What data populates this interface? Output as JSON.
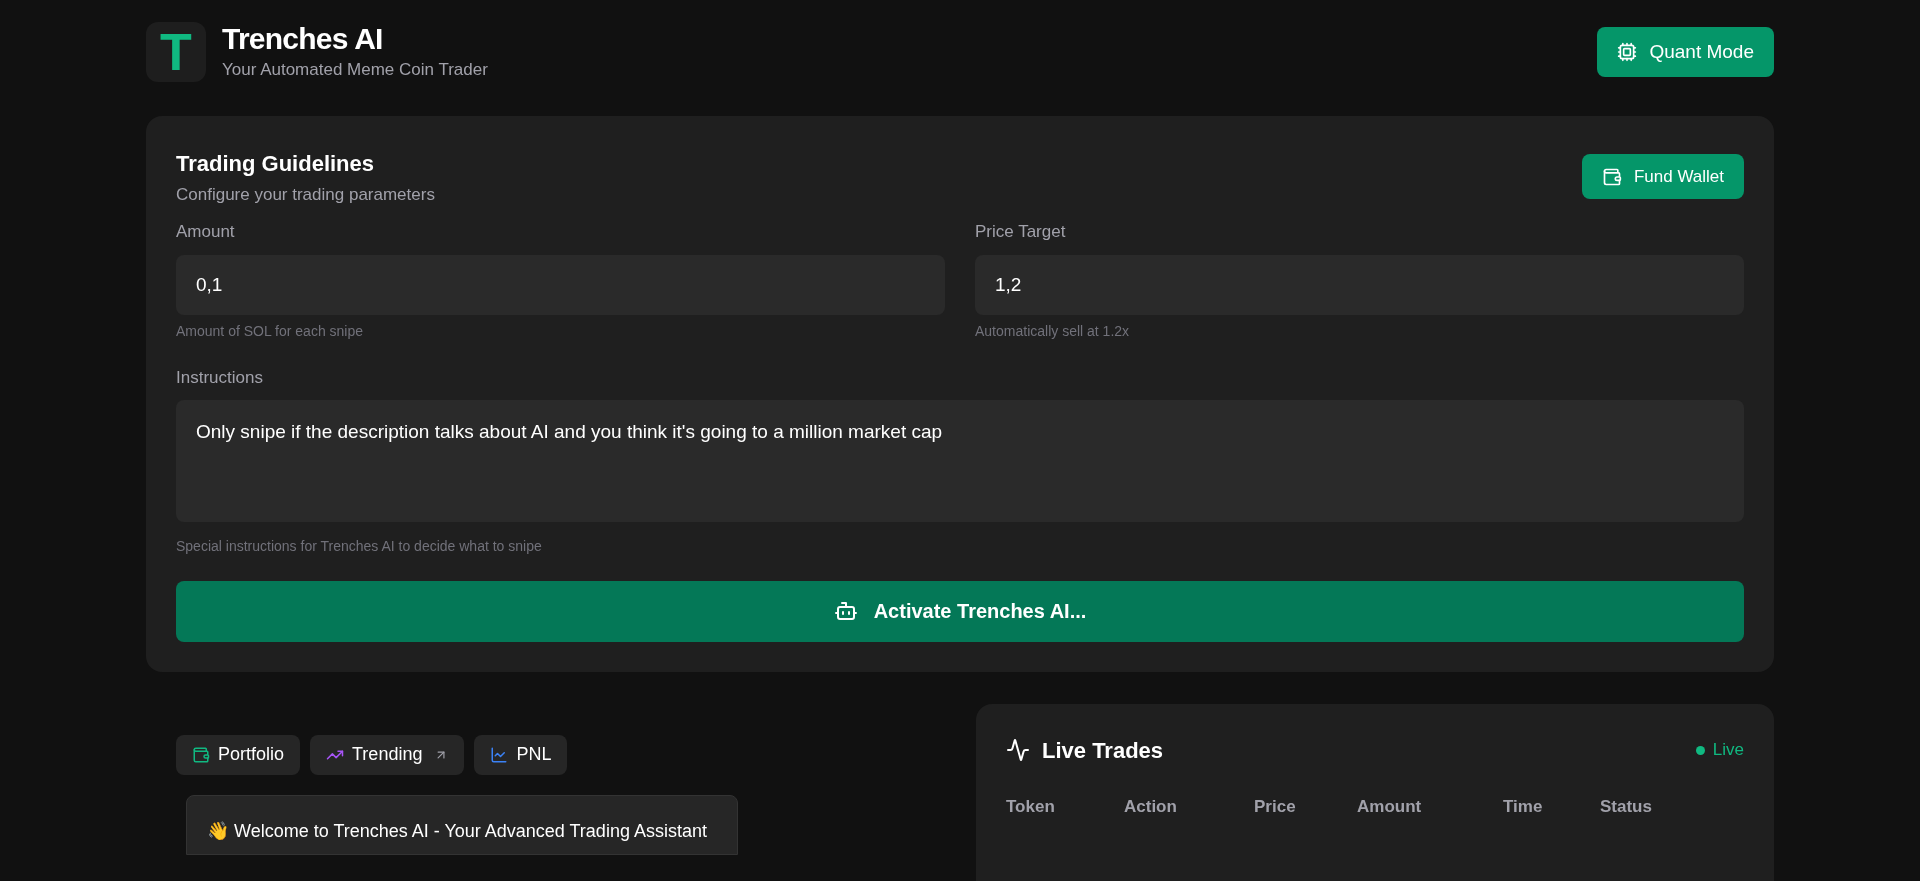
{
  "header": {
    "logo_letter": "T",
    "title": "Trenches AI",
    "subtitle": "Your Automated Meme Coin Trader",
    "quant_button": "Quant Mode"
  },
  "guidelines": {
    "title": "Trading Guidelines",
    "subtitle": "Configure your trading parameters",
    "fund_button": "Fund Wallet",
    "fields": [
      {
        "label": "Amount",
        "value": "0,1",
        "hint": "Amount of SOL for each snipe"
      },
      {
        "label": "Price Target",
        "value": "1,2",
        "hint": "Automatically sell at 1.2x"
      }
    ],
    "instructions": {
      "label": "Instructions",
      "value": "Only snipe if the description talks about AI and you think it's going to a million market cap",
      "hint": "Special instructions for Trenches AI to decide what to snipe"
    },
    "activate_button": "Activate Trenches AI..."
  },
  "tabs": [
    {
      "label": "Portfolio",
      "kind": "wallet"
    },
    {
      "label": "Trending",
      "kind": "trending"
    },
    {
      "label": "PNL",
      "kind": "chart"
    }
  ],
  "chat": {
    "message": "👋 Welcome to Trenches AI - Your Advanced Trading Assistant"
  },
  "live_trades": {
    "title": "Live Trades",
    "status": "Live",
    "columns": [
      "Token",
      "Action",
      "Price",
      "Amount",
      "Time",
      "Status"
    ]
  }
}
